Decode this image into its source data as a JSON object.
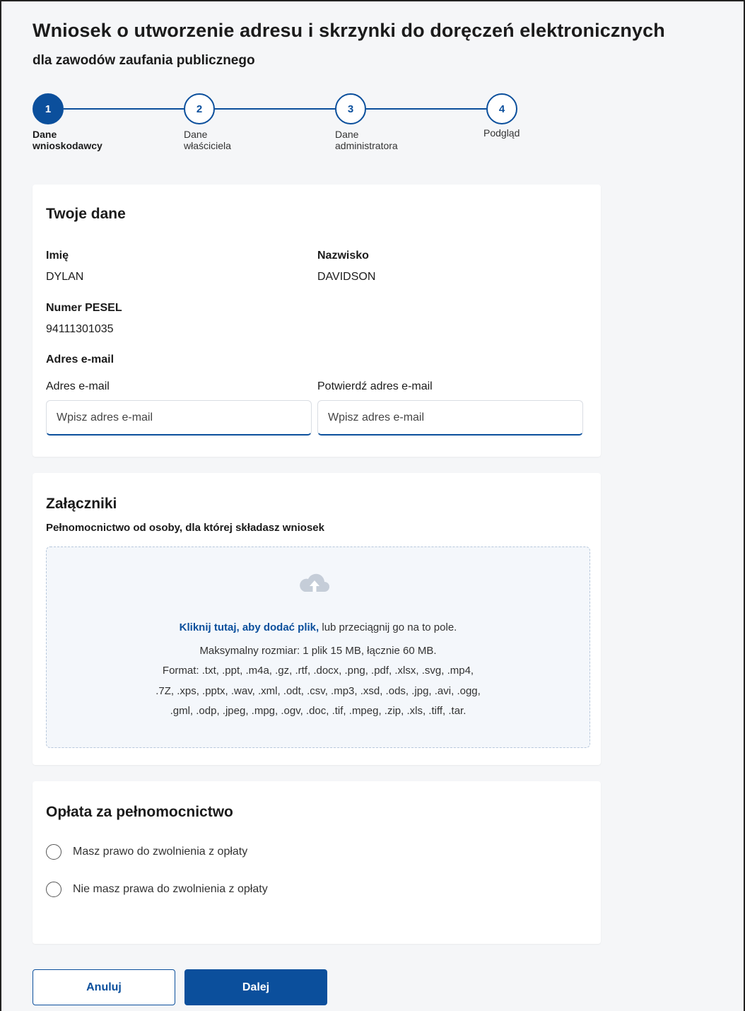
{
  "header": {
    "title": "Wniosek o utworzenie adresu i skrzynki do doręczeń elektronicznych",
    "subtitle": "dla zawodów zaufania publicznego"
  },
  "stepper": {
    "steps": [
      {
        "number": "1",
        "label": "Dane wnioskodawcy",
        "label_line1": "Dane",
        "label_line2": "wnioskodawcy",
        "state": "active"
      },
      {
        "number": "2",
        "label": "Dane właściciela",
        "label_line1": "Dane",
        "label_line2": "właściciela",
        "state": "pending"
      },
      {
        "number": "3",
        "label": "Dane administratora",
        "label_line1": "Dane",
        "label_line2": "administratora",
        "state": "pending"
      },
      {
        "number": "4",
        "label": "Podgląd",
        "label_line1": "Podgląd",
        "label_line2": "",
        "state": "pending"
      }
    ]
  },
  "your_data": {
    "heading": "Twoje dane",
    "first_name_label": "Imię",
    "first_name_value": "DYLAN",
    "last_name_label": "Nazwisko",
    "last_name_value": "DAVIDSON",
    "pesel_label": "Numer PESEL",
    "pesel_value": "94111301035",
    "email_section_label": "Adres e-mail",
    "email_label": "Adres e-mail",
    "email_placeholder": "Wpisz adres e-mail",
    "email_value": "",
    "email_confirm_label": "Potwierdź adres e-mail",
    "email_confirm_placeholder": "Wpisz adres e-mail",
    "email_confirm_value": ""
  },
  "attachments": {
    "heading": "Załączniki",
    "subheading": "Pełnomocnictwo od osoby, dla której składasz wniosek",
    "upload_icon": "cloud-upload-icon",
    "link_text": "Kliknij tutaj, aby dodać plik,",
    "drag_text": " lub przeciągnij go na to pole.",
    "max_size": "Maksymalny rozmiar: 1 plik 15 MB, łącznie 60 MB.",
    "formats_line1": "Format: .txt, .ppt, .m4a, .gz, .rtf, .docx, .png, .pdf, .xlsx, .svg, .mp4,",
    "formats_line2": ".7Z, .xps, .pptx, .wav, .xml, .odt, .csv, .mp3, .xsd, .ods, .jpg, .avi, .ogg,",
    "formats_line3": ".gml, .odp, .jpeg, .mpg, .ogv, .doc, .tif, .mpeg, .zip, .xls, .tiff, .tar."
  },
  "fee": {
    "heading": "Opłata za pełnomocnictwo",
    "options": [
      {
        "label": "Masz prawo do zwolnienia z opłaty",
        "selected": false
      },
      {
        "label": "Nie masz prawa do zwolnienia z opłaty",
        "selected": false
      }
    ]
  },
  "actions": {
    "cancel_label": "Anuluj",
    "next_label": "Dalej"
  },
  "colors": {
    "accent": "#0b4f9c",
    "background": "#f5f6f8",
    "card": "#ffffff",
    "dropzone_bg": "#f4f7fb",
    "cloud_icon": "#c5cdd8"
  }
}
